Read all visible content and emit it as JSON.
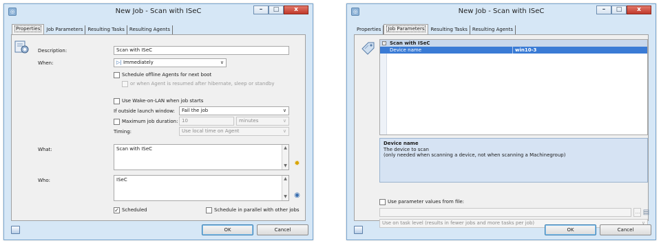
{
  "left": {
    "title": "New Job - Scan with ISeC",
    "tabs": [
      "Properties",
      "Job Parameters",
      "Resulting Tasks",
      "Resulting Agents"
    ],
    "description_label": "Description:",
    "description_value": "Scan with ISeC",
    "when_label": "When:",
    "when_value": "Immediately",
    "schedule_offline": "Schedule offline Agents for next boot",
    "resumed_option": "or when Agent is resumed after hibernate, sleep or standby",
    "wol": "Use Wake-on-LAN when job starts",
    "outside_label": "If outside launch window:",
    "outside_value": "Fail the job",
    "max_duration_label": "Maximum job duration:",
    "max_duration_value": "10",
    "max_duration_unit": "minutes",
    "timing_label": "Timing:",
    "timing_value": "Use local time on Agent",
    "what_label": "What:",
    "what_value": "Scan with ISeC",
    "who_label": "Who:",
    "who_value": "ISeC",
    "scheduled": "Scheduled",
    "parallel": "Schedule in parallel with other jobs",
    "ok": "OK",
    "cancel": "Cancel"
  },
  "right": {
    "title": "New Job - Scan with ISeC",
    "tabs": [
      "Properties",
      "Job Parameters",
      "Resulting Tasks",
      "Resulting Agents"
    ],
    "category": "Scan with ISeC",
    "row_key": "Device name",
    "row_value": "win10-3",
    "desc_title": "Device name",
    "desc_line1": "The device to scan",
    "desc_line2": "(only needed when scanning a device, not when scanning a Machinegroup)",
    "use_param_file": "Use parameter values from file:",
    "browse": "...",
    "task_level": "Use on task level (results in fewer jobs and more tasks per job)",
    "ok": "OK",
    "cancel": "Cancel"
  },
  "colors": {
    "window_frame": "#d6e7f6",
    "selection": "#3a7bd5",
    "close_button": "#c0392b"
  }
}
